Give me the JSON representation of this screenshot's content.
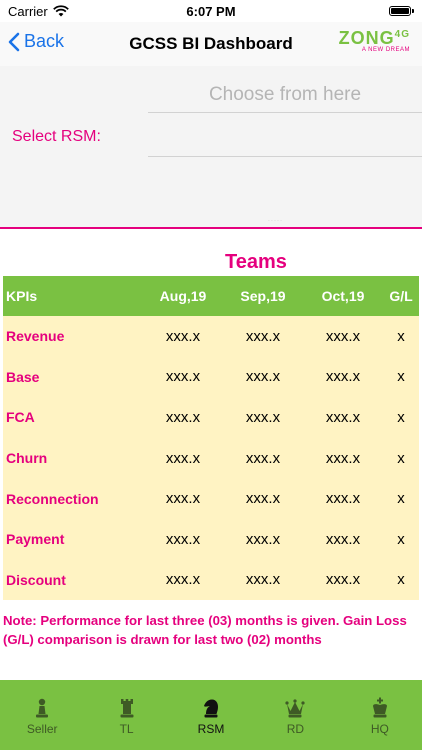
{
  "status_bar": {
    "carrier": "Carrier",
    "time": "6:07 PM"
  },
  "nav": {
    "back_label": "Back",
    "title": "GCSS BI Dashboard",
    "logo_text": "ZONG",
    "logo_sup": "4G",
    "logo_tagline": "A NEW DREAM"
  },
  "picker": {
    "label": "Select RSM:",
    "placeholder": "Choose from here",
    "tiny_text": "- - - - -"
  },
  "section_title": "Teams",
  "table": {
    "headers": [
      "KPIs",
      "Aug,19",
      "Sep,19",
      "Oct,19",
      "G/L"
    ],
    "rows": [
      {
        "kpi": "Revenue",
        "aug": "xxx.x",
        "sep": "xxx.x",
        "oct": "xxx.x",
        "gl": "x"
      },
      {
        "kpi": "Base",
        "aug": "xxx.x",
        "sep": "xxx.x",
        "oct": "xxx.x",
        "gl": "x"
      },
      {
        "kpi": "FCA",
        "aug": "xxx.x",
        "sep": "xxx.x",
        "oct": "xxx.x",
        "gl": "x"
      },
      {
        "kpi": "Churn",
        "aug": "xxx.x",
        "sep": "xxx.x",
        "oct": "xxx.x",
        "gl": "x"
      },
      {
        "kpi": "Reconnection",
        "aug": "xxx.x",
        "sep": "xxx.x",
        "oct": "xxx.x",
        "gl": "x"
      },
      {
        "kpi": "Payment",
        "aug": "xxx.x",
        "sep": "xxx.x",
        "oct": "xxx.x",
        "gl": "x"
      },
      {
        "kpi": "Discount",
        "aug": "xxx.x",
        "sep": "xxx.x",
        "oct": "xxx.x",
        "gl": "x"
      }
    ]
  },
  "note": "Note: Performance for last three (03) months is given. Gain Loss (G/L) comparison is drawn for last two (02) months",
  "tabs": [
    {
      "label": "Seller",
      "icon": "pawn-icon",
      "active": false
    },
    {
      "label": "TL",
      "icon": "rook-icon",
      "active": false
    },
    {
      "label": "RSM",
      "icon": "knight-icon",
      "active": true
    },
    {
      "label": "RD",
      "icon": "queen-icon",
      "active": false
    },
    {
      "label": "HQ",
      "icon": "king-icon",
      "active": false
    }
  ],
  "colors": {
    "accent_green": "#7ac142",
    "accent_pink": "#e5007e",
    "table_body": "#fff3c3",
    "link_blue": "#1a73e8"
  }
}
